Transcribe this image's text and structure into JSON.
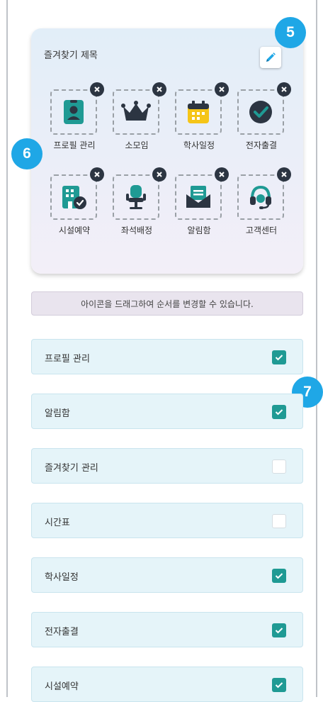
{
  "favorites": {
    "title": "즐겨찾기 제목",
    "tiles": [
      {
        "label": "프로필 관리",
        "icon": "id-card-icon"
      },
      {
        "label": "소모임",
        "icon": "crown-icon"
      },
      {
        "label": "학사일정",
        "icon": "calendar-icon"
      },
      {
        "label": "전자출결",
        "icon": "check-circle-icon"
      },
      {
        "label": "시설예약",
        "icon": "building-check-icon"
      },
      {
        "label": "좌석배정",
        "icon": "seat-icon"
      },
      {
        "label": "알림함",
        "icon": "mail-icon"
      },
      {
        "label": "고객센터",
        "icon": "headset-icon"
      }
    ]
  },
  "hint": "아이콘을 드래그하여 순서를 변경할 수 있습니다.",
  "badges": {
    "b5": "5",
    "b6": "6",
    "b7": "7"
  },
  "menu_items": [
    {
      "label": "프로필 관리",
      "checked": true
    },
    {
      "label": "알림함",
      "checked": true
    },
    {
      "label": "즐겨찾기 관리",
      "checked": false
    },
    {
      "label": "시간표",
      "checked": false
    },
    {
      "label": "학사일정",
      "checked": true
    },
    {
      "label": "전자출결",
      "checked": true
    },
    {
      "label": "시설예약",
      "checked": true
    }
  ],
  "colors": {
    "accent_teal": "#1f9a94",
    "badge_blue": "#1fa7e6",
    "card_dark": "#2c3542",
    "icon_yellow": "#f5c518"
  }
}
